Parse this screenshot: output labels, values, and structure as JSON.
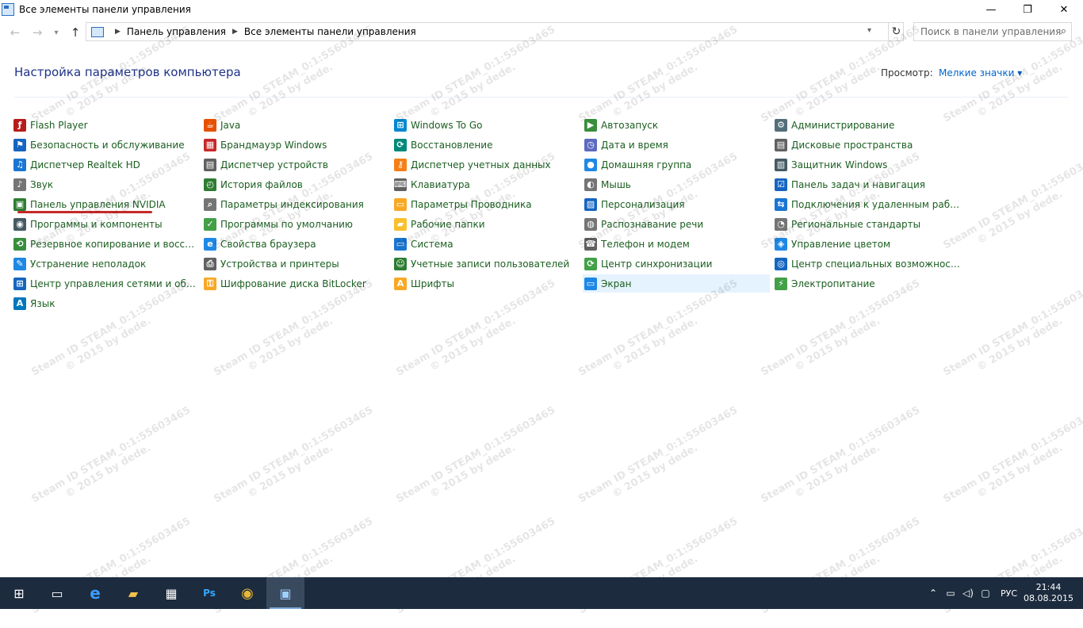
{
  "window": {
    "title": "Все элементы панели управления",
    "minimize": "—",
    "restore": "❐",
    "close": "✕"
  },
  "nav": {
    "back": "←",
    "forward": "→",
    "recent": "▾",
    "up": "↑",
    "breadcrumbs": [
      "Панель управления",
      "Все элементы панели управления"
    ],
    "refresh": "↻",
    "search_placeholder": "Поиск в панели управления"
  },
  "header": {
    "title": "Настройка параметров компьютера",
    "view_label": "Просмотр:",
    "view_value": "Мелкие значки"
  },
  "columns": [
    [
      {
        "label": "Flash Player",
        "icon": "flash-player-icon",
        "color": "#b71c1c",
        "glyph": "ƒ"
      },
      {
        "label": "Безопасность и обслуживание",
        "icon": "security-flag-icon",
        "color": "#1565c0",
        "glyph": "⚑"
      },
      {
        "label": "Диспетчер Realtek HD",
        "icon": "realtek-audio-icon",
        "color": "#1976d2",
        "glyph": "♫"
      },
      {
        "label": "Звук",
        "icon": "speaker-icon",
        "color": "#757575",
        "glyph": "♪"
      },
      {
        "label": "Панель управления NVIDIA",
        "icon": "nvidia-icon",
        "color": "#2e7d32",
        "glyph": "▣"
      },
      {
        "label": "Программы и компоненты",
        "icon": "programs-icon",
        "color": "#455a64",
        "glyph": "◉"
      },
      {
        "label": "Резервное копирование и восстан...",
        "icon": "backup-icon",
        "color": "#388e3c",
        "glyph": "⟲"
      },
      {
        "label": "Устранение неполадок",
        "icon": "troubleshoot-icon",
        "color": "#1e88e5",
        "glyph": "✎"
      },
      {
        "label": "Центр управления сетями и общи...",
        "icon": "network-icon",
        "color": "#1565c0",
        "glyph": "⊞"
      },
      {
        "label": "Язык",
        "icon": "language-icon",
        "color": "#0277bd",
        "glyph": "A"
      }
    ],
    [
      {
        "label": "Java",
        "icon": "java-icon",
        "color": "#e65100",
        "glyph": "☕"
      },
      {
        "label": "Брандмауэр Windows",
        "icon": "firewall-icon",
        "color": "#c62828",
        "glyph": "▦"
      },
      {
        "label": "Диспетчер устройств",
        "icon": "device-manager-icon",
        "color": "#616161",
        "glyph": "▤"
      },
      {
        "label": "История файлов",
        "icon": "file-history-icon",
        "color": "#2e7d32",
        "glyph": "◴"
      },
      {
        "label": "Параметры индексирования",
        "icon": "indexing-icon",
        "color": "#757575",
        "glyph": "⌕"
      },
      {
        "label": "Программы по умолчанию",
        "icon": "default-programs-icon",
        "color": "#43a047",
        "glyph": "✓"
      },
      {
        "label": "Свойства браузера",
        "icon": "browser-icon",
        "color": "#1e88e5",
        "glyph": "e"
      },
      {
        "label": "Устройства и принтеры",
        "icon": "printer-icon",
        "color": "#616161",
        "glyph": "⎙"
      },
      {
        "label": "Шифрование диска BitLocker",
        "icon": "bitlocker-icon",
        "color": "#f9a825",
        "glyph": "⚿"
      }
    ],
    [
      {
        "label": "Windows To Go",
        "icon": "windows-to-go-icon",
        "color": "#0288d1",
        "glyph": "⊞"
      },
      {
        "label": "Восстановление",
        "icon": "recovery-icon",
        "color": "#00897b",
        "glyph": "⟳"
      },
      {
        "label": "Диспетчер учетных данных",
        "icon": "credentials-icon",
        "color": "#f57f17",
        "glyph": "⚷"
      },
      {
        "label": "Клавиатура",
        "icon": "keyboard-icon",
        "color": "#616161",
        "glyph": "⌨"
      },
      {
        "label": "Параметры Проводника",
        "icon": "explorer-options-icon",
        "color": "#f9a825",
        "glyph": "▭"
      },
      {
        "label": "Рабочие папки",
        "icon": "work-folders-icon",
        "color": "#fbc02d",
        "glyph": "▰"
      },
      {
        "label": "Система",
        "icon": "system-icon",
        "color": "#1976d2",
        "glyph": "▭"
      },
      {
        "label": "Учетные записи пользователей",
        "icon": "user-accounts-icon",
        "color": "#2e7d32",
        "glyph": "☺"
      },
      {
        "label": "Шрифты",
        "icon": "fonts-icon",
        "color": "#f9a825",
        "glyph": "A"
      }
    ],
    [
      {
        "label": "Автозапуск",
        "icon": "autoplay-icon",
        "color": "#388e3c",
        "glyph": "▶"
      },
      {
        "label": "Дата и время",
        "icon": "date-time-icon",
        "color": "#5c6bc0",
        "glyph": "◷"
      },
      {
        "label": "Домашняя группа",
        "icon": "homegroup-icon",
        "color": "#1e88e5",
        "glyph": "●"
      },
      {
        "label": "Мышь",
        "icon": "mouse-icon",
        "color": "#757575",
        "glyph": "◐"
      },
      {
        "label": "Персонализация",
        "icon": "personalization-icon",
        "color": "#1565c0",
        "glyph": "▨"
      },
      {
        "label": "Распознавание речи",
        "icon": "microphone-icon",
        "color": "#757575",
        "glyph": "◍"
      },
      {
        "label": "Телефон и модем",
        "icon": "phone-modem-icon",
        "color": "#616161",
        "glyph": "☎"
      },
      {
        "label": "Центр синхронизации",
        "icon": "sync-center-icon",
        "color": "#43a047",
        "glyph": "⟳"
      },
      {
        "label": "Экран",
        "icon": "display-icon",
        "color": "#1e88e5",
        "glyph": "▭",
        "selected": true
      }
    ],
    [
      {
        "label": "Администрирование",
        "icon": "administration-icon",
        "color": "#546e7a",
        "glyph": "⚙"
      },
      {
        "label": "Дисковые пространства",
        "icon": "storage-spaces-icon",
        "color": "#616161",
        "glyph": "▤"
      },
      {
        "label": "Защитник Windows",
        "icon": "defender-icon",
        "color": "#455a64",
        "glyph": "▥"
      },
      {
        "label": "Панель задач и навигация",
        "icon": "taskbar-icon",
        "color": "#1565c0",
        "glyph": "☑"
      },
      {
        "label": "Подключения к удаленным рабоч...",
        "icon": "remote-desktop-icon",
        "color": "#1976d2",
        "glyph": "⇆"
      },
      {
        "label": "Региональные стандарты",
        "icon": "region-icon",
        "color": "#757575",
        "glyph": "◔"
      },
      {
        "label": "Управление цветом",
        "icon": "color-management-icon",
        "color": "#1e88e5",
        "glyph": "◈"
      },
      {
        "label": "Центр специальных возможностей",
        "icon": "ease-of-access-icon",
        "color": "#1565c0",
        "glyph": "◎"
      },
      {
        "label": "Электропитание",
        "icon": "power-icon",
        "color": "#43a047",
        "glyph": "⚡"
      }
    ]
  ],
  "watermark": {
    "line1": "Steam ID  STEAM_0:1:55603465",
    "line2": "© 2015 by dede."
  },
  "taskbar": {
    "apps": [
      {
        "name": "start-button",
        "glyph": "⊞"
      },
      {
        "name": "task-view-button",
        "glyph": "▭"
      },
      {
        "name": "edge-button",
        "glyph": "e"
      },
      {
        "name": "file-explorer-button",
        "glyph": "▰"
      },
      {
        "name": "store-button",
        "glyph": "▦"
      },
      {
        "name": "photoshop-button",
        "glyph": "Ps"
      },
      {
        "name": "chrome-button",
        "glyph": "◉"
      },
      {
        "name": "control-panel-taskbar-button",
        "glyph": "▣",
        "active": true
      }
    ],
    "tray": {
      "chevron": "⌃",
      "network": "▭",
      "volume": "◁)",
      "notifications": "▢",
      "lang": "РУС",
      "time": "21:44",
      "date": "08.08.2015"
    }
  }
}
